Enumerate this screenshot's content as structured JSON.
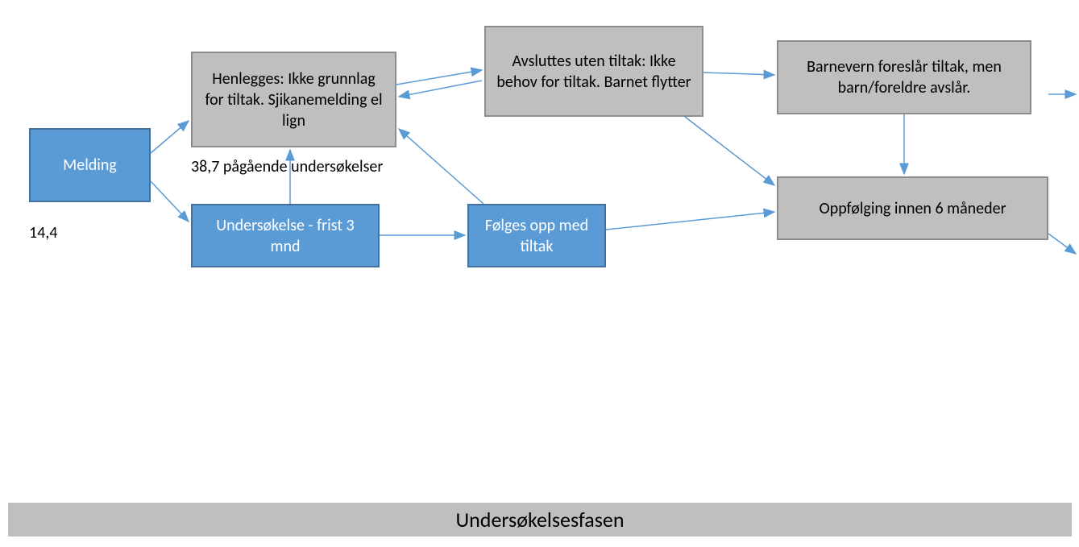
{
  "nodes": {
    "melding": {
      "text": "Melding"
    },
    "henlegges": {
      "text": "Henlegges: Ikke grunnlag for tiltak. Sjikanemelding el lign"
    },
    "undersokelse": {
      "text": "Undersøkelse - frist 3 mnd"
    },
    "avsluttes": {
      "text": "Avsluttes uten tiltak: Ikke behov for tiltak.  Barnet flytter"
    },
    "folges": {
      "text": "Følges opp med tiltak"
    },
    "barnevern": {
      "text": "Barnevern foreslår tiltak, men barn/foreldre avslår."
    },
    "oppfolging": {
      "text": "Oppfølging innen 6 måneder"
    }
  },
  "labels": {
    "melding_value": "14,4",
    "undersokelser_value": "38,7 pågående undersøkelser"
  },
  "footer": {
    "text": "Undersøkelsesfasen"
  }
}
